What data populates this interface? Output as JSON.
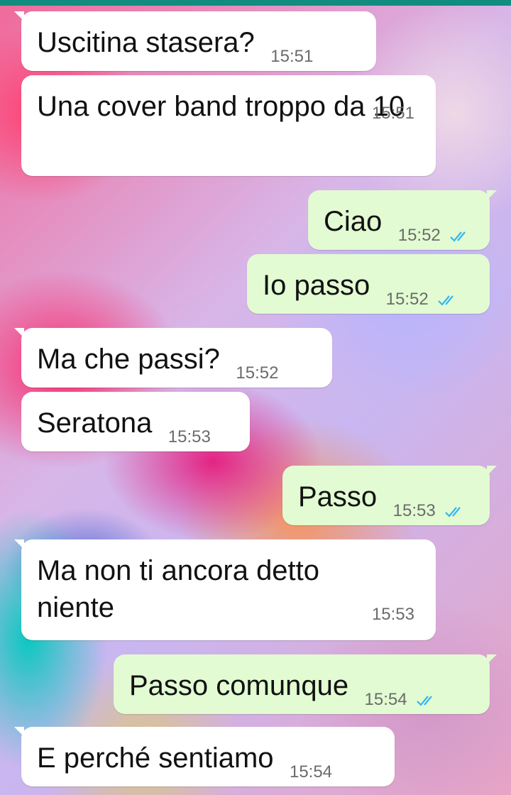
{
  "colors": {
    "incoming_bubble": "#ffffff",
    "outgoing_bubble": "#e2fbd2",
    "read_ticks": "#34B7F1",
    "top_bar": "#128C7E"
  },
  "messages": [
    {
      "text": "Uscitina stasera?",
      "time": "15:51",
      "direction": "incoming"
    },
    {
      "text": "Una cover band troppo da 10",
      "time": "15:51",
      "direction": "incoming"
    },
    {
      "text": "Ciao",
      "time": "15:52",
      "direction": "outgoing",
      "status_icon": "double-check-read-icon"
    },
    {
      "text": "Io passo",
      "time": "15:52",
      "direction": "outgoing",
      "status_icon": "double-check-read-icon"
    },
    {
      "text": "Ma che passi?",
      "time": "15:52",
      "direction": "incoming"
    },
    {
      "text": "Seratona",
      "time": "15:53",
      "direction": "incoming"
    },
    {
      "text": "Passo",
      "time": "15:53",
      "direction": "outgoing",
      "status_icon": "double-check-read-icon"
    },
    {
      "text": "Ma non ti ancora detto niente",
      "time": "15:53",
      "direction": "incoming"
    },
    {
      "text": "Passo comunque",
      "time": "15:54",
      "direction": "outgoing",
      "status_icon": "double-check-read-icon"
    },
    {
      "text": "E perché sentiamo",
      "time": "15:54",
      "direction": "incoming"
    }
  ]
}
